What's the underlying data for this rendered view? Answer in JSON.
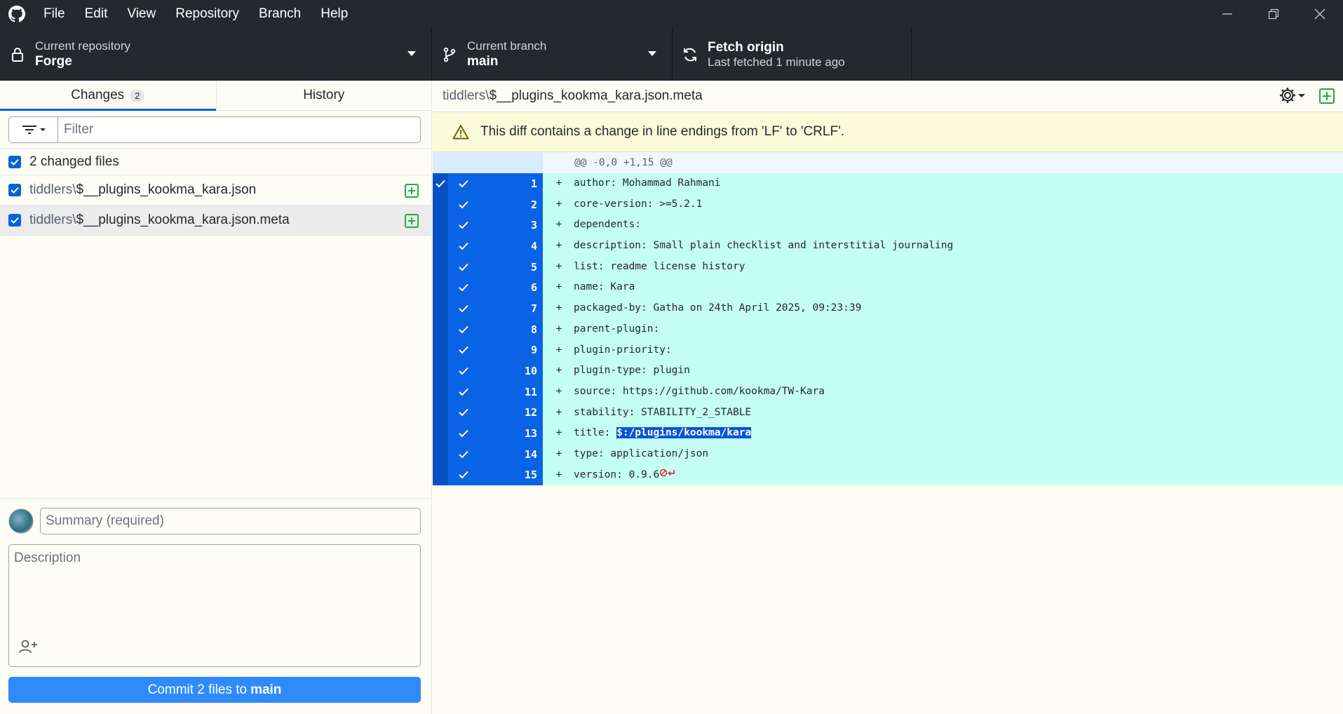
{
  "menu": [
    "File",
    "Edit",
    "View",
    "Repository",
    "Branch",
    "Help"
  ],
  "toolbar": {
    "repo_caption": "Current repository",
    "repo_name": "Forge",
    "branch_caption": "Current branch",
    "branch_name": "main",
    "fetch_title": "Fetch origin",
    "fetch_status": "Last fetched 1 minute ago"
  },
  "tabs": {
    "changes": "Changes",
    "changes_count": "2",
    "history": "History"
  },
  "filter": {
    "placeholder": "Filter"
  },
  "changed_files_label": "2 changed files",
  "files": [
    {
      "dir": "tiddlers\\",
      "name": "$__plugins_kookma_kara.json"
    },
    {
      "dir": "tiddlers\\",
      "name": "$__plugins_kookma_kara.json.meta"
    }
  ],
  "commit": {
    "summary_placeholder": "Summary (required)",
    "description_placeholder": "Description",
    "button_prefix": "Commit 2 files to",
    "button_branch": "main"
  },
  "diff": {
    "file_dir": "tiddlers\\",
    "file_name": "$__plugins_kookma_kara.json.meta",
    "warning": "This diff contains a change in line endings from 'LF' to 'CRLF'.",
    "hunk_header": "@@ -0,0 +1,15 @@",
    "lines": [
      {
        "n": "1",
        "text": "author: Mohammad Rahmani"
      },
      {
        "n": "2",
        "text": "core-version: >=5.2.1"
      },
      {
        "n": "3",
        "text": "dependents:"
      },
      {
        "n": "4",
        "text": "description: Small plain checklist and interstitial journaling"
      },
      {
        "n": "5",
        "text": "list: readme license history"
      },
      {
        "n": "6",
        "text": "name: Kara"
      },
      {
        "n": "7",
        "text": "packaged-by: Gatha on 24th April 2025, 09:23:39"
      },
      {
        "n": "8",
        "text": "parent-plugin:"
      },
      {
        "n": "9",
        "text": "plugin-priority:"
      },
      {
        "n": "10",
        "text": "plugin-type: plugin"
      },
      {
        "n": "11",
        "text": "source: https://github.com/kookma/TW-Kara"
      },
      {
        "n": "12",
        "text": "stability: STABILITY_2_STABLE"
      },
      {
        "n": "13",
        "text": "title: ",
        "highlight": "$:/plugins/kookma/kara"
      },
      {
        "n": "14",
        "text": "type: application/json"
      },
      {
        "n": "15",
        "text": "version: 0.9.6",
        "eol_marker": true
      }
    ]
  },
  "colors": {
    "chrome": "#24292e",
    "accent": "#0366d6",
    "added_bg": "#c5fef2",
    "gutter_selected": "#0a63e5",
    "commit_button": "#2f8bfc"
  }
}
